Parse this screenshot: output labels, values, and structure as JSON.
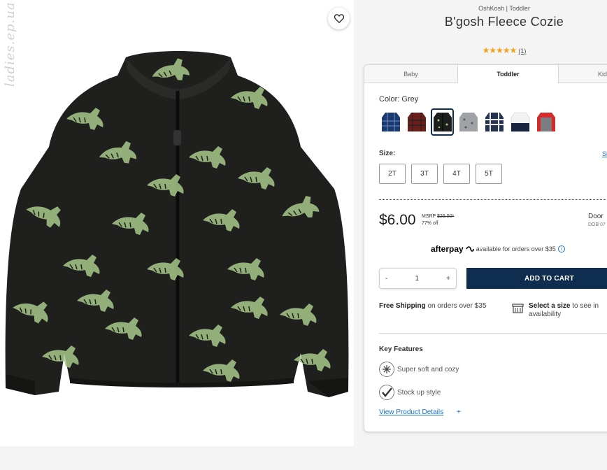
{
  "image": {
    "watermark": "ladies.ep.ua",
    "favorite_icon": "heart-outline-icon",
    "product_color": "#1f201e",
    "print_color": "#a8c98a"
  },
  "product": {
    "brand": "OshKosh | Toddler",
    "title": "B'gosh Fleece Cozie",
    "rating_stars": "★★★★★",
    "rating_count": "(1)"
  },
  "tabs": [
    {
      "label": "Baby",
      "active": false
    },
    {
      "label": "Toddler",
      "active": true
    },
    {
      "label": "Kid",
      "active": false
    }
  ],
  "color": {
    "label": "Color:",
    "value": "Grey",
    "swatches": [
      {
        "name": "navy-plaid",
        "hex": "#1b3b6f"
      },
      {
        "name": "red-plaid",
        "hex": "#6b1f1a"
      },
      {
        "name": "dino-black",
        "hex": "#1d1f1c",
        "selected": true
      },
      {
        "name": "grey-print",
        "hex": "#9fa2a6"
      },
      {
        "name": "navy-white-plaid",
        "hex": "#24324f"
      },
      {
        "name": "navy-white",
        "hex": "#1a2440"
      },
      {
        "name": "red-grey",
        "hex": "#d62a2a"
      }
    ]
  },
  "size": {
    "label": "Size:",
    "guide_label": "Si",
    "options": [
      "2T",
      "3T",
      "4T",
      "5T"
    ]
  },
  "pricing": {
    "price": "$6.00",
    "msrp_label": "MSRP",
    "msrp_value": "$26.00*",
    "discount": "77% off",
    "door_label": "Door",
    "door_sub": "DOB 07"
  },
  "afterpay": {
    "logo": "afterpay",
    "text": "available for orders over $35",
    "info_icon": "info-circle-icon"
  },
  "cart": {
    "minus": "-",
    "quantity": "1",
    "plus": "+",
    "add_label": "ADD TO CART"
  },
  "shipping": {
    "bold": "Free Shipping",
    "text": " on orders over $35"
  },
  "store": {
    "icon": "store-icon",
    "bold": "Select a size",
    "text": " to see in",
    "text2": "availability"
  },
  "features": {
    "title": "Key Features",
    "items": [
      {
        "label": "Super soft and cozy",
        "icon": "snowflake-icon"
      },
      {
        "label": "Stock up style",
        "icon": "checkmark-icon"
      }
    ],
    "details_link": "View Product Details",
    "details_plus": "+"
  }
}
